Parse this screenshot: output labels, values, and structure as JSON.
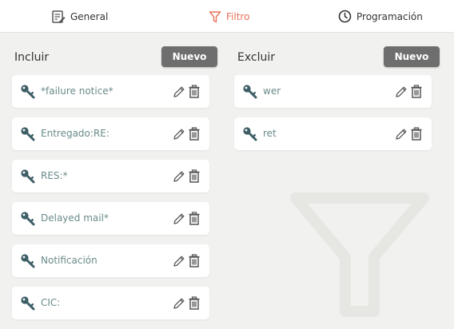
{
  "tabs": {
    "general": "General",
    "filtro": "Filtro",
    "programacion": "Programación"
  },
  "incluir": {
    "title": "Incluir",
    "new_button": "Nuevo",
    "items": [
      {
        "label": "*failure notice*"
      },
      {
        "label": "Entregado:RE:"
      },
      {
        "label": "RES:*"
      },
      {
        "label": "Delayed mail*"
      },
      {
        "label": "Notificación"
      },
      {
        "label": "CIC:"
      }
    ]
  },
  "excluir": {
    "title": "Excluir",
    "new_button": "Nuevo",
    "items": [
      {
        "label": "wer"
      },
      {
        "label": "ret"
      }
    ]
  },
  "icons": {
    "tab_general": "document-edit-icon",
    "tab_filtro": "filter-icon",
    "tab_programacion": "clock-icon",
    "item_key": "key-icon",
    "item_edit": "pencil-icon",
    "item_delete": "trash-icon",
    "background": "filter-watermark-icon"
  },
  "colors": {
    "accent": "#e8735a",
    "button_bg": "#6e6e6e",
    "key_icon": "#3e5e66",
    "item_text": "#6a8a8a",
    "background": "#f1f1ef"
  }
}
